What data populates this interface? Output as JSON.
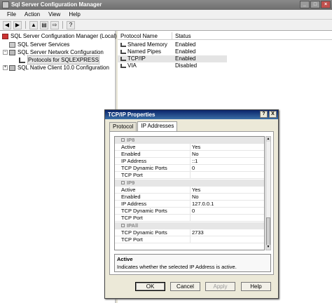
{
  "window": {
    "title": "Sql Server Configuration Manager"
  },
  "menu": [
    "File",
    "Action",
    "View",
    "Help"
  ],
  "toolbar": {
    "back": "◀",
    "forward": "▶",
    "up": "▲",
    "props": "▤",
    "export": "⇨",
    "help": "?"
  },
  "tree": [
    {
      "label": "SQL Server Configuration Manager (Local)",
      "expander": ""
    },
    {
      "label": "SQL Server Services",
      "expander": ""
    },
    {
      "label": "SQL Server Network Configuration",
      "expander": "−"
    },
    {
      "label": "Protocols for SQLEXPRESS",
      "expander": ""
    },
    {
      "label": "SQL Native Client 10.0 Configuration",
      "expander": "+"
    }
  ],
  "list": {
    "headers": {
      "name": "Protocol Name",
      "status": "Status"
    },
    "rows": [
      {
        "name": "Shared Memory",
        "status": "Enabled"
      },
      {
        "name": "Named Pipes",
        "status": "Enabled"
      },
      {
        "name": "TCP/IP",
        "status": "Enabled"
      },
      {
        "name": "VIA",
        "status": "Disabled"
      }
    ]
  },
  "dialog": {
    "title": "TCP/IP Properties",
    "help_btn": "?",
    "close_btn": "X",
    "tabs": [
      "Protocol",
      "IP Addresses"
    ],
    "grid": [
      {
        "group": "IP8",
        "gm": "−"
      },
      {
        "k": "Active",
        "v": "Yes"
      },
      {
        "k": "Enabled",
        "v": "No"
      },
      {
        "k": "IP Address",
        "v": "::1"
      },
      {
        "k": "TCP Dynamic Ports",
        "v": "0"
      },
      {
        "k": "TCP Port",
        "v": ""
      },
      {
        "group": "IP9",
        "gm": "−"
      },
      {
        "k": "Active",
        "v": "Yes"
      },
      {
        "k": "Enabled",
        "v": "No"
      },
      {
        "k": "IP Address",
        "v": "127.0.0.1"
      },
      {
        "k": "TCP Dynamic Ports",
        "v": "0"
      },
      {
        "k": "TCP Port",
        "v": ""
      },
      {
        "group": "IPAll",
        "gm": "−"
      },
      {
        "k": "TCP Dynamic Ports",
        "v": "2733"
      },
      {
        "k": "TCP Port",
        "v": ""
      }
    ],
    "scroll": {
      "up": "▲",
      "down": "▼"
    },
    "description": {
      "title": "Active",
      "text": "Indicates whether the selected IP Address is active."
    },
    "buttons": {
      "ok": "OK",
      "cancel": "Cancel",
      "apply": "Apply",
      "help": "Help"
    }
  }
}
